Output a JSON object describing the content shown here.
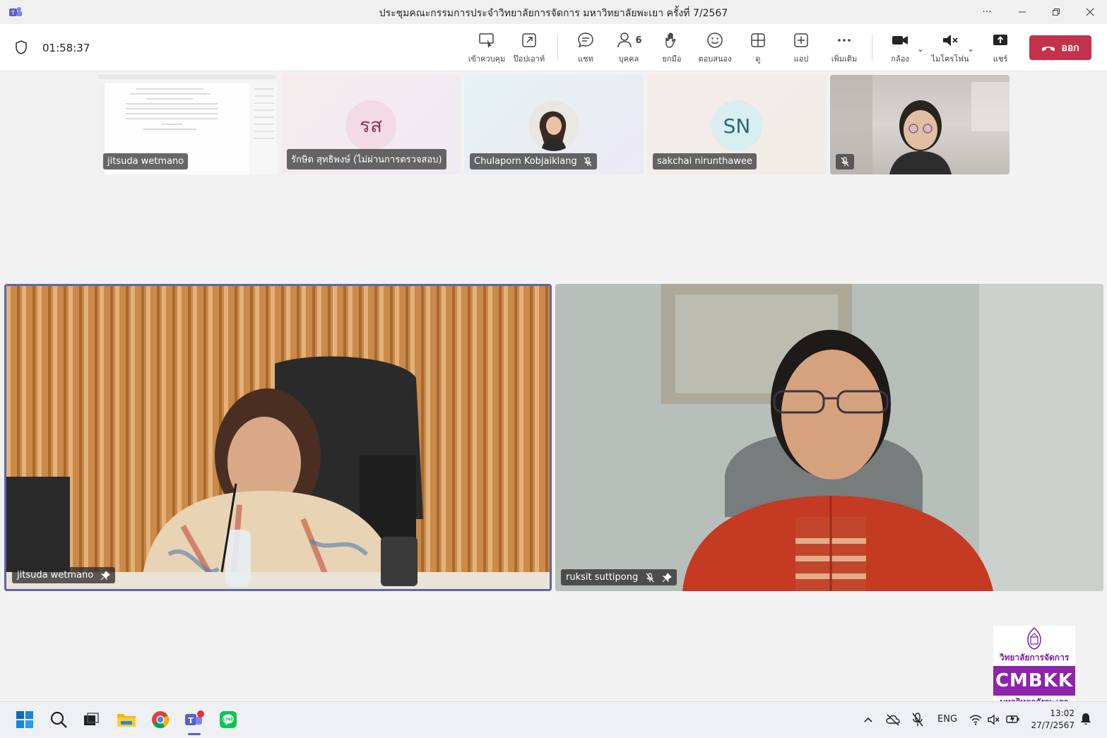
{
  "window": {
    "title": "ประชุมคณะกรรมการประจำวิทยาลัยการจัดการ มหาวิทยาลัยพะเยา ครั้งที่ 7/2567"
  },
  "meeting": {
    "timer": "01:58:37",
    "leave_label": "ออก"
  },
  "toolbar": {
    "items": [
      {
        "label": "เข้าควบคุม",
        "icon": "take-control-icon"
      },
      {
        "label": "ป๊อปเอาท์",
        "icon": "popout-icon"
      },
      {
        "label": "แชท",
        "icon": "chat-icon"
      },
      {
        "label": "บุคคล",
        "icon": "people-icon",
        "badge": "6"
      },
      {
        "label": "ยกมือ",
        "icon": "raise-hand-icon"
      },
      {
        "label": "ตอบสนอง",
        "icon": "react-icon"
      },
      {
        "label": "ดู",
        "icon": "view-icon"
      },
      {
        "label": "แอป",
        "icon": "apps-icon"
      },
      {
        "label": "เพิ่มเติม",
        "icon": "more-icon"
      },
      {
        "label": "กล้อง",
        "icon": "camera-icon"
      },
      {
        "label": "ไมโครโฟน",
        "icon": "mic-icon"
      },
      {
        "label": "แชร์",
        "icon": "share-icon"
      }
    ]
  },
  "participants_top": [
    {
      "name": "jitsuda wetmano",
      "type": "screen-share"
    },
    {
      "name": "รักษิต สุทธิพงษ์ (ไม่ผ่านการตรวจสอบ)",
      "initials": "รส"
    },
    {
      "name": "Chulaporn Kobjaiklang",
      "type": "photo"
    },
    {
      "name": "sakchai nirunthawee",
      "initials": "SN"
    },
    {
      "name": "",
      "type": "video"
    }
  ],
  "participants_main": [
    {
      "name": "jitsuda wetmano"
    },
    {
      "name": "ruksit suttipong"
    }
  ],
  "logo": {
    "line1": "วิทยาลัยการจัดการ",
    "line2": "CMBKK",
    "line3": "มหาวิทยาลัยพะเยา"
  },
  "taskbar": {
    "language": "ENG",
    "time": "13:02",
    "date": "27/7/2567"
  },
  "colors": {
    "leave": "#c4314b",
    "accent": "#6264a7",
    "logo": "#8e24aa"
  }
}
